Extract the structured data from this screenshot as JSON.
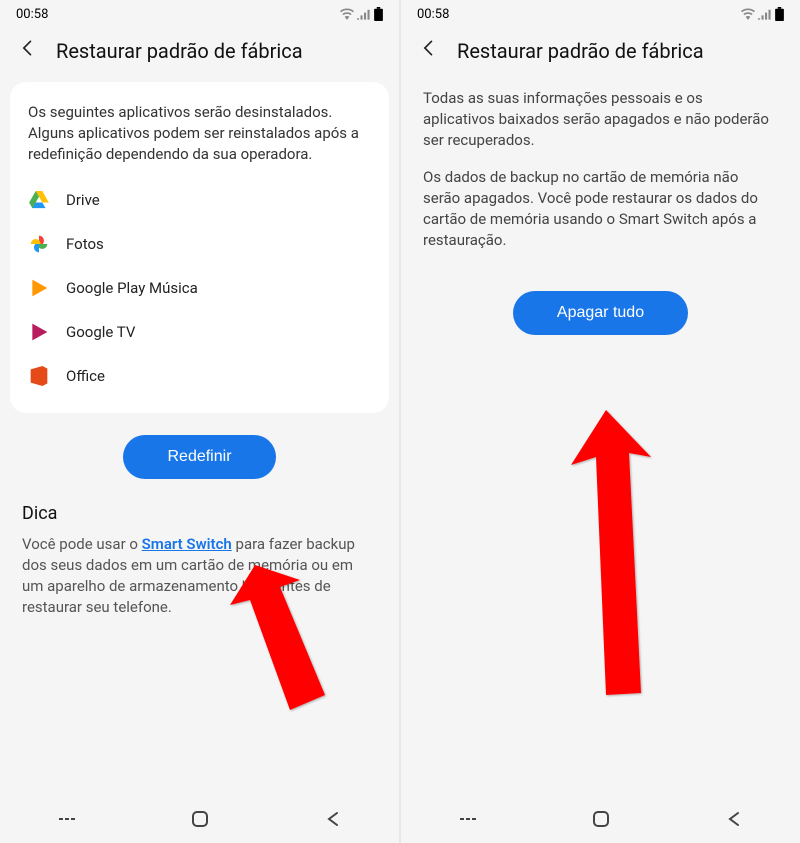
{
  "status": {
    "time": "00:58"
  },
  "left": {
    "title": "Restaurar padrão de fábrica",
    "card_text": "Os seguintes aplicativos serão desinstalados. Alguns aplicativos podem ser reinstalados após a redefinição dependendo da sua operadora.",
    "apps": [
      {
        "name": "Drive"
      },
      {
        "name": "Fotos"
      },
      {
        "name": "Google Play Música"
      },
      {
        "name": "Google TV"
      },
      {
        "name": "Office"
      }
    ],
    "button_label": "Redefinir",
    "tip_title": "Dica",
    "tip_before": "Você pode usar o ",
    "tip_link": "Smart Switch",
    "tip_after": " para fazer backup dos seus dados em um cartão de memória ou em um aparelho de armazenamento USB antes de restaurar seu telefone."
  },
  "right": {
    "title": "Restaurar padrão de fábrica",
    "paragraph1": "Todas as suas informações pessoais e os aplicativos baixados serão apagados e não poderão ser recuperados.",
    "paragraph2": "Os dados de backup no cartão de memória não serão apagados. Você pode restaurar os dados do cartão de memória usando o Smart Switch após a restauração.",
    "button_label": "Apagar tudo"
  }
}
